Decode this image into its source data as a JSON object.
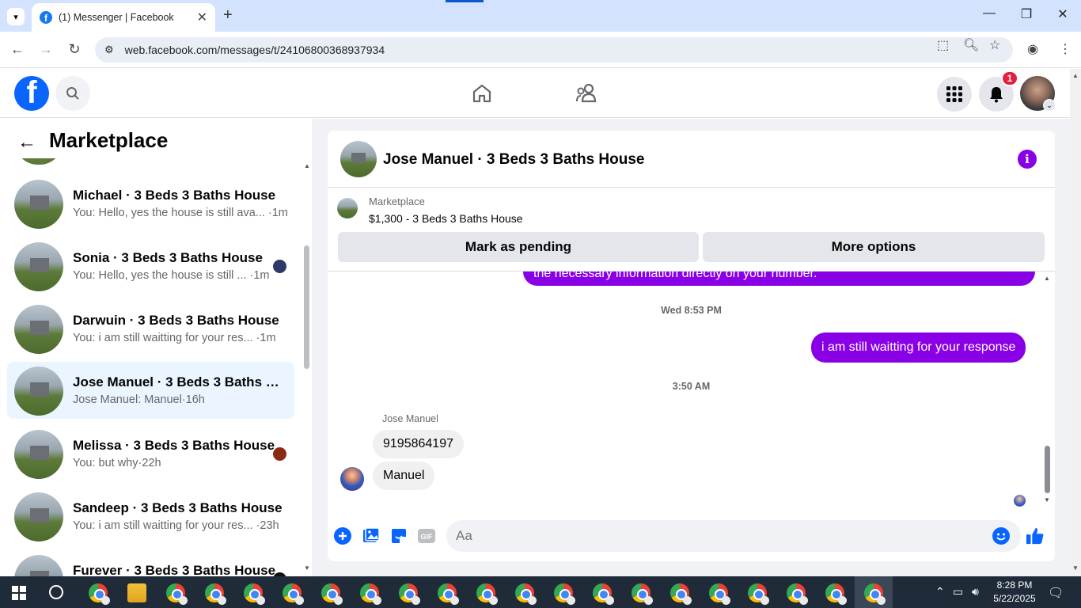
{
  "browser": {
    "tab_title": "(1) Messenger | Facebook",
    "url": "web.facebook.com/messages/t/24106800368937934",
    "new_tab": "+",
    "tab_close": "✕"
  },
  "header": {
    "notification_count": "1"
  },
  "sidebar": {
    "title": "Marketplace",
    "conversations": [
      {
        "name": "Michael · 3 Beds 3 Baths House",
        "preview": "You: Hello, yes the house is still ava... ·1m",
        "avatar_color": ""
      },
      {
        "name": "Sonia · 3 Beds 3 Baths House",
        "preview": "You: Hello, yes the house is still ... ·1m",
        "avatar_color": "#2b3a6b"
      },
      {
        "name": "Darwuin · 3 Beds 3 Baths House",
        "preview": "You: i am still waitting for your res... ·1m",
        "avatar_color": ""
      },
      {
        "name": "Jose Manuel · 3 Beds 3 Baths Ho...",
        "preview": "Jose Manuel: Manuel·16h",
        "avatar_color": "",
        "active": true
      },
      {
        "name": "Melissa · 3 Beds 3 Baths House",
        "preview": "You: but why·22h",
        "avatar_color": "#8a2a10"
      },
      {
        "name": "Sandeep · 3 Beds 3 Baths House",
        "preview": "You: i am still waitting for your res... ·23h",
        "avatar_color": ""
      },
      {
        "name": "Furever · 3 Beds 3 Baths House",
        "preview": "",
        "avatar_color": "#111111"
      }
    ]
  },
  "chat": {
    "title": "Jose Manuel · 3 Beds 3 Baths House",
    "listing_label": "Marketplace",
    "listing_price": "$1,300 - 3 Beds 3 Baths House",
    "mark_pending": "Mark as pending",
    "more_options": "More options",
    "partial_message": "the necessary information directly on your number.",
    "timestamp1": "Wed 8:53 PM",
    "outgoing_message": "i am still waitting for your response",
    "timestamp2": "3:50 AM",
    "sender_name": "Jose Manuel",
    "incoming_messages": [
      "9195864197",
      "Manuel"
    ],
    "input_placeholder": "Aa",
    "accent_color": "#8a00e6"
  },
  "taskbar": {
    "time": "8:28 PM",
    "date": "5/22/2025"
  }
}
